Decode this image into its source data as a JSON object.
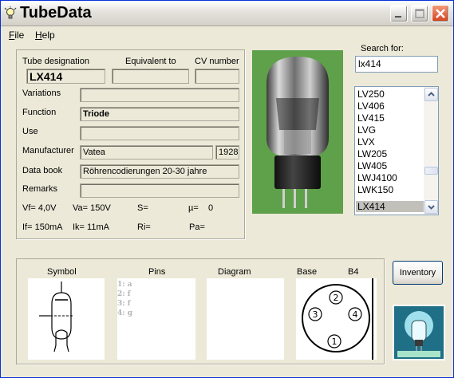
{
  "window": {
    "title": "TubeData"
  },
  "menu": {
    "file": "File",
    "help": "Help"
  },
  "tube": {
    "designation_label": "Tube designation",
    "equivalent_label": "Equivalent to",
    "cv_label": "CV number",
    "designation": "LX414",
    "equivalent": "",
    "cv": "",
    "variations_label": "Variations",
    "variations": "",
    "function_label": "Function",
    "function": "Triode",
    "use_label": "Use",
    "use": "",
    "manufacturer_label": "Manufacturer",
    "manufacturer": "Vatea",
    "year": "1928",
    "databook_label": "Data book",
    "databook": "Röhrencodierungen 20-30 jahre",
    "remarks_label": "Remarks",
    "remarks": ""
  },
  "params": {
    "vf": "Vf= 4,0V",
    "va": "Va= 150V",
    "s": "S=",
    "mu": "µ=",
    "mu_val": "0",
    "if": "If= 150mA",
    "ik": "Ik= 11mA",
    "ri": "Ri=",
    "pa": "Pa="
  },
  "search": {
    "label": "Search for:",
    "value": "lx414",
    "results": [
      "LV250",
      "LV406",
      "LV415",
      "LVG",
      "LVX",
      "LW205",
      "LW405",
      "LWJ4100",
      "LWK150",
      "LX414"
    ],
    "selected": "LX414"
  },
  "bottom": {
    "symbol_label": "Symbol",
    "pins_label": "Pins",
    "diagram_label": "Diagram",
    "base_label": "Base",
    "base_code": "B4",
    "pins": [
      "1: a",
      "2: f",
      "3: f",
      "4: g"
    ],
    "base_pin_numbers": [
      "1",
      "2",
      "3",
      "4"
    ]
  },
  "inventory_label": "Inventory",
  "icons": {
    "app": "lightbulb-icon",
    "minimize": "minimize-icon",
    "maximize": "maximize-icon",
    "close": "close-icon",
    "scroll_up": "chevron-up-icon",
    "scroll_down": "chevron-down-icon"
  },
  "colors": {
    "title_bar": "#d4d0c8",
    "close_button": "#d4411d",
    "photo_bg": "#5fa04a",
    "list_selected": "#c1c0bb"
  }
}
